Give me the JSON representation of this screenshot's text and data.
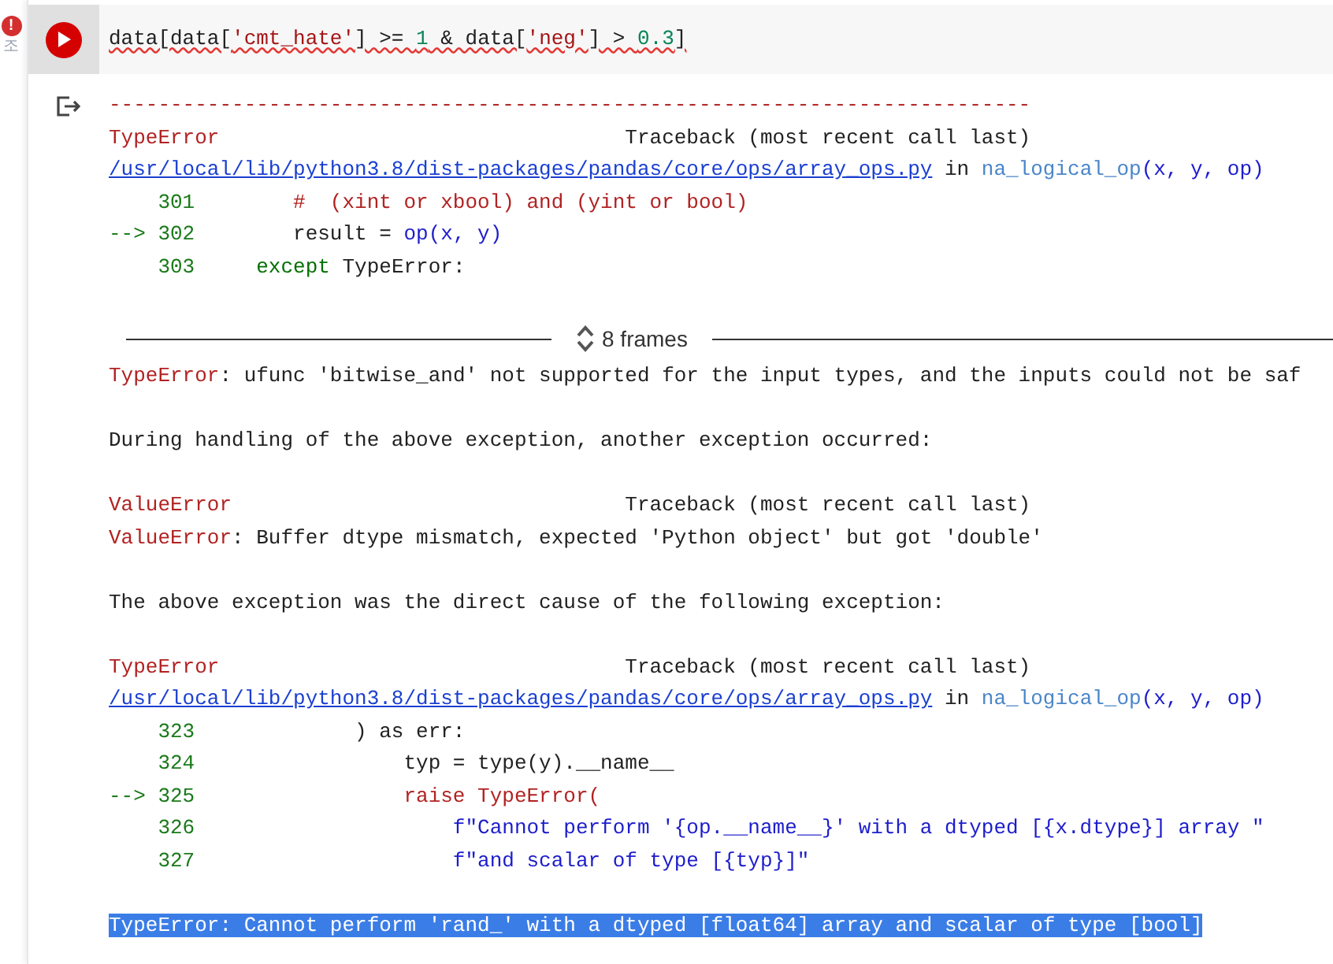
{
  "cell": {
    "error_badge": "!",
    "side_label": "조",
    "code": [
      {
        "text": "data[data[",
        "kind": "plain"
      },
      {
        "text": "'cmt_hate'",
        "kind": "string"
      },
      {
        "text": "] >= ",
        "kind": "plain"
      },
      {
        "text": "1",
        "kind": "number"
      },
      {
        "text": " & data[",
        "kind": "plain"
      },
      {
        "text": "'neg'",
        "kind": "string"
      },
      {
        "text": "] > ",
        "kind": "plain"
      },
      {
        "text": "0.3",
        "kind": "number"
      },
      {
        "text": "]",
        "kind": "plain"
      }
    ],
    "has_error": true
  },
  "output": {
    "lines": [
      {
        "kind": "code",
        "segments": [
          {
            "text": "---------------------------------------------------------------------------",
            "kind": "error"
          }
        ]
      },
      {
        "kind": "code",
        "segments": [
          {
            "text": "TypeError",
            "kind": "error"
          },
          {
            "text": "                                 Traceback (most recent call last)",
            "kind": "plain"
          }
        ]
      },
      {
        "kind": "code",
        "segments": [
          {
            "text": "/usr/local/lib/python3.8/dist-packages/pandas/core/ops/array_ops.py",
            "kind": "link"
          },
          {
            "text": " in ",
            "kind": "plain"
          },
          {
            "text": "na_logical_op",
            "kind": "func"
          },
          {
            "text": "(x, y, op)",
            "kind": "call"
          }
        ]
      },
      {
        "kind": "code",
        "segments": [
          {
            "text": "    301",
            "kind": "lineno"
          },
          {
            "text": "        #  (xint or xbool) and (yint or bool)",
            "kind": "error"
          }
        ]
      },
      {
        "kind": "code",
        "segments": [
          {
            "text": "--> 302",
            "kind": "lineno"
          },
          {
            "text": "        result = ",
            "kind": "plain"
          },
          {
            "text": "op(x, y)",
            "kind": "call"
          }
        ]
      },
      {
        "kind": "code",
        "segments": [
          {
            "text": "    303",
            "kind": "lineno"
          },
          {
            "text": "     except",
            "kind": "keyword"
          },
          {
            "text": " TypeError:",
            "kind": "plain"
          }
        ]
      },
      {
        "kind": "frames",
        "label": "8 frames"
      },
      {
        "kind": "code",
        "segments": [
          {
            "text": "TypeError",
            "kind": "error"
          },
          {
            "text": ": ufunc 'bitwise_and' not supported for the input types, and the inputs could not be saf",
            "kind": "plain"
          }
        ]
      },
      {
        "kind": "blank"
      },
      {
        "kind": "code",
        "segments": [
          {
            "text": "During handling of the above exception, another exception occurred:",
            "kind": "plain"
          }
        ]
      },
      {
        "kind": "blank"
      },
      {
        "kind": "code",
        "segments": [
          {
            "text": "ValueError",
            "kind": "error"
          },
          {
            "text": "                                Traceback (most recent call last)",
            "kind": "plain"
          }
        ]
      },
      {
        "kind": "code",
        "segments": [
          {
            "text": "ValueError",
            "kind": "error"
          },
          {
            "text": ": Buffer dtype mismatch, expected 'Python object' but got 'double'",
            "kind": "plain"
          }
        ]
      },
      {
        "kind": "blank"
      },
      {
        "kind": "code",
        "segments": [
          {
            "text": "The above exception was the direct cause of the following exception:",
            "kind": "plain"
          }
        ]
      },
      {
        "kind": "blank"
      },
      {
        "kind": "code",
        "segments": [
          {
            "text": "TypeError",
            "kind": "error"
          },
          {
            "text": "                                 Traceback (most recent call last)",
            "kind": "plain"
          }
        ]
      },
      {
        "kind": "code",
        "segments": [
          {
            "text": "/usr/local/lib/python3.8/dist-packages/pandas/core/ops/array_ops.py",
            "kind": "link"
          },
          {
            "text": " in ",
            "kind": "plain"
          },
          {
            "text": "na_logical_op",
            "kind": "func"
          },
          {
            "text": "(x, y, op)",
            "kind": "call"
          }
        ]
      },
      {
        "kind": "code",
        "segments": [
          {
            "text": "    323",
            "kind": "lineno"
          },
          {
            "text": "             ) as err:",
            "kind": "plain"
          }
        ]
      },
      {
        "kind": "code",
        "segments": [
          {
            "text": "    324",
            "kind": "lineno"
          },
          {
            "text": "                 typ = type(y).__name__",
            "kind": "plain"
          }
        ]
      },
      {
        "kind": "code",
        "segments": [
          {
            "text": "--> 325",
            "kind": "lineno"
          },
          {
            "text": "                 raise TypeError(",
            "kind": "error"
          }
        ]
      },
      {
        "kind": "code",
        "segments": [
          {
            "text": "    326",
            "kind": "lineno"
          },
          {
            "text": "                     f\"Cannot perform '{op.__name__}' with a dtyped [{x.dtype}] array \"",
            "kind": "call"
          }
        ]
      },
      {
        "kind": "code",
        "segments": [
          {
            "text": "    327",
            "kind": "lineno"
          },
          {
            "text": "                     f\"and scalar of type [{typ}]\"",
            "kind": "call"
          }
        ]
      },
      {
        "kind": "blank"
      },
      {
        "kind": "selected",
        "segments": [
          {
            "text": "TypeError: Cannot perform 'rand_' with a dtyped [float64] array and scalar of type [bool]"
          }
        ]
      }
    ]
  }
}
